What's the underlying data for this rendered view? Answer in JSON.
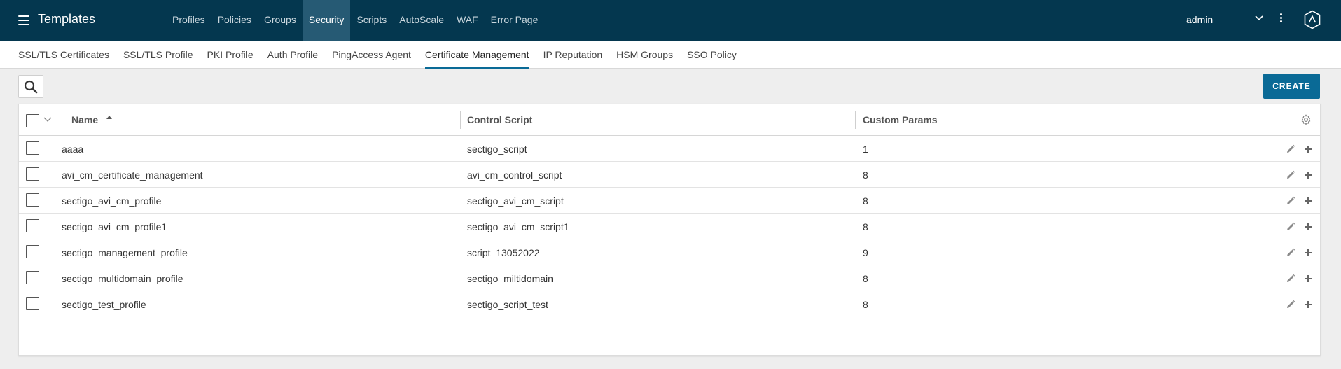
{
  "app": {
    "title": "Templates"
  },
  "top_nav": {
    "items": [
      {
        "label": "Profiles"
      },
      {
        "label": "Policies"
      },
      {
        "label": "Groups"
      },
      {
        "label": "Security"
      },
      {
        "label": "Scripts"
      },
      {
        "label": "AutoScale"
      },
      {
        "label": "WAF"
      },
      {
        "label": "Error Page"
      }
    ],
    "active": "Security"
  },
  "user": {
    "name": "admin"
  },
  "sub_nav": {
    "items": [
      {
        "label": "SSL/TLS Certificates"
      },
      {
        "label": "SSL/TLS Profile"
      },
      {
        "label": "PKI Profile"
      },
      {
        "label": "Auth Profile"
      },
      {
        "label": "PingAccess Agent"
      },
      {
        "label": "Certificate Management"
      },
      {
        "label": "IP Reputation"
      },
      {
        "label": "HSM Groups"
      },
      {
        "label": "SSO Policy"
      }
    ],
    "active": "Certificate Management"
  },
  "toolbar": {
    "create_label": "CREATE"
  },
  "table": {
    "columns": [
      "Name",
      "Control Script",
      "Custom Params"
    ],
    "sort": {
      "column": "Name",
      "direction": "ascending"
    },
    "rows": [
      {
        "name": "aaaa",
        "control_script": "sectigo_script",
        "custom_params": "1"
      },
      {
        "name": "avi_cm_certificate_management",
        "control_script": "avi_cm_control_script",
        "custom_params": "8"
      },
      {
        "name": "sectigo_avi_cm_profile",
        "control_script": "sectigo_avi_cm_script",
        "custom_params": "8"
      },
      {
        "name": "sectigo_avi_cm_profile1",
        "control_script": "sectigo_avi_cm_script1",
        "custom_params": "8"
      },
      {
        "name": "sectigo_management_profile",
        "control_script": "script_13052022",
        "custom_params": "9"
      },
      {
        "name": "sectigo_multidomain_profile",
        "control_script": "sectigo_miltidomain",
        "custom_params": "8"
      },
      {
        "name": "sectigo_test_profile",
        "control_script": "sectigo_script_test",
        "custom_params": "8"
      }
    ]
  },
  "icons": {
    "menu": "hamburger-icon",
    "user_menu": "chevron-down-icon",
    "more": "kebab-icon",
    "brand": "avi-logo-icon",
    "search": "search-icon",
    "sort": "sort-ascending-icon",
    "settings": "gear-icon",
    "edit": "pencil-icon",
    "expand": "plus-icon"
  },
  "colors": {
    "topnav_bg": "#04374f",
    "topnav_active_bg": "#265a74",
    "accent": "#0a6a96",
    "page_bg": "#eeeeee"
  }
}
